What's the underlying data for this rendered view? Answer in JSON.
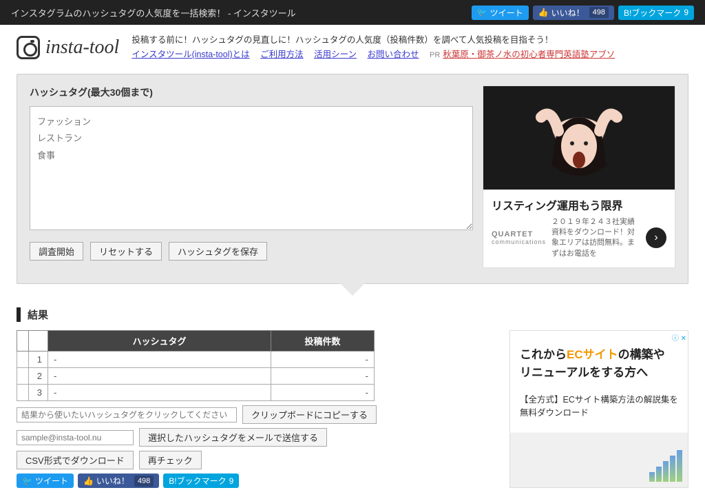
{
  "topbar": {
    "title": "インスタグラムのハッシュタグの人気度を一括検索！ - インスタツール",
    "tweet": "ツイート",
    "like": "いいね！",
    "like_count": "498",
    "bookmark": "B!ブックマーク",
    "bookmark_count": "9"
  },
  "logo": {
    "text": "insta-tool"
  },
  "intro": {
    "line1": "投稿する前に！ハッシュタグの見直しに！ハッシュタグの人気度（投稿件数）を調べて人気投稿を目指そう！",
    "link_about": "インスタツール(insta-tool)とは",
    "link_usage": "ご利用方法",
    "link_scene": "活用シーン",
    "link_contact": "お問い合わせ",
    "pr": "PR",
    "pr_link": "秋葉原・御茶ノ水の初心者専門英語塾アブソ"
  },
  "input": {
    "label": "ハッシュタグ(最大30個まで)",
    "placeholder": "ファッション\nレストラン\n食事",
    "btn_start": "調査開始",
    "btn_reset": "リセットする",
    "btn_save": "ハッシュタグを保存"
  },
  "ad1": {
    "badge": "ⓘ ✕",
    "title": "リスティング運用もう限界",
    "brand": "QUARTET",
    "brand_sub": "communications",
    "desc": "２０１９年２４３社実績資料をダウンロード！対象エリアは訪問無料。まずはお電話を"
  },
  "results": {
    "heading": "結果",
    "col_tag": "ハッシュタグ",
    "col_count": "投稿件数",
    "rows": [
      {
        "n": "1",
        "tag": "-",
        "cnt": "-"
      },
      {
        "n": "2",
        "tag": "-",
        "cnt": "-"
      },
      {
        "n": "3",
        "tag": "-",
        "cnt": "-"
      }
    ],
    "click_placeholder": "結果から使いたいハッシュタグをクリックしてください",
    "btn_copy": "クリップボードにコピーする",
    "email_placeholder": "sample@insta-tool.nu",
    "btn_mail": "選択したハッシュタグをメールで送信する",
    "btn_csv": "CSV形式でダウンロード",
    "btn_recheck": "再チェック"
  },
  "ad2": {
    "badge": "ⓘ ✕",
    "line1a": "これから",
    "line1b": "ECサイト",
    "line1c": "の構築や",
    "line2": "リニューアルをする方へ",
    "sub": "【全方式】ECサイト構築方法の解説集を無料ダウンロード"
  }
}
